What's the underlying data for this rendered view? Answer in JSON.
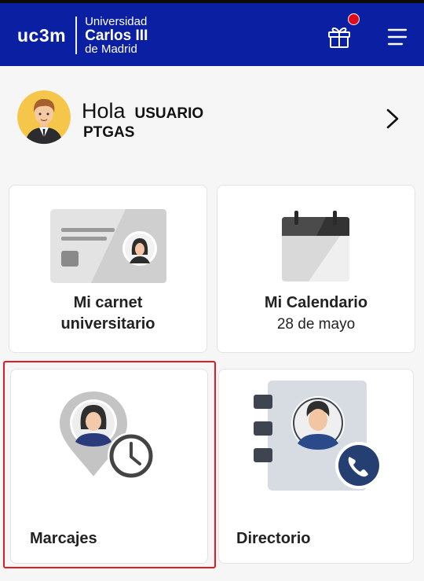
{
  "header": {
    "logo_short": "uc3m",
    "logo_line1": "Universidad",
    "logo_line2": "Carlos III",
    "logo_line3": "de Madrid",
    "gift_icon": "gift-icon",
    "menu_icon": "hamburger-menu-icon",
    "notification": "red-dot-badge"
  },
  "greeting": {
    "hello": "Hola",
    "user_line1": "USUARIO",
    "user_line2": "PTGAS"
  },
  "cards": {
    "carnet": {
      "title_line1": "Mi carnet",
      "title_line2": "universitario"
    },
    "calendar": {
      "title": "Mi Calendario",
      "date": "28 de mayo"
    },
    "marcajes": {
      "title": "Marcajes"
    },
    "directorio": {
      "title": "Directorio"
    }
  },
  "colors": {
    "header_bg": "#0b1fa3",
    "highlight": "#e01b24",
    "badge": "#e00a1a"
  }
}
